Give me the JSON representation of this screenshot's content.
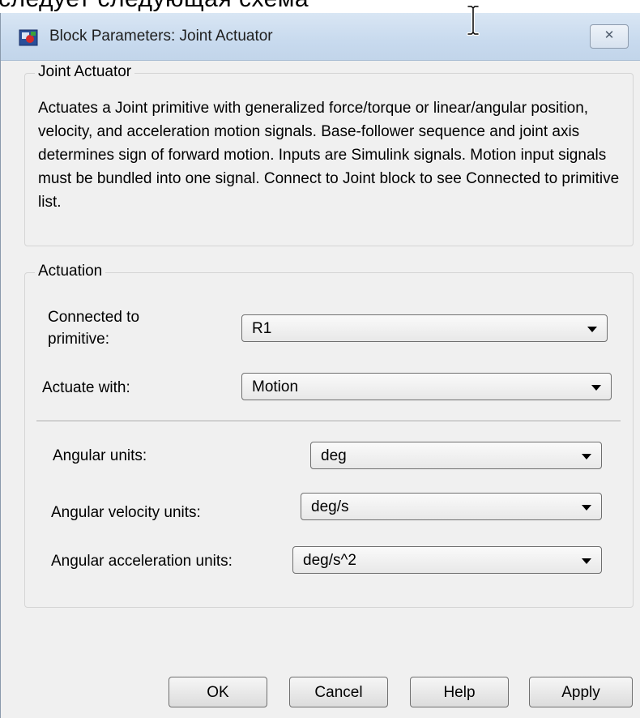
{
  "background_text": "следует следующая схема",
  "window": {
    "title": "Block Parameters: Joint Actuator",
    "close_glyph": "✕"
  },
  "description_group": {
    "title": "Joint Actuator",
    "text": "Actuates a Joint primitive with generalized force/torque or linear/angular position, velocity, and acceleration motion signals. Base-follower sequence and joint axis determines sign of forward motion. Inputs are Simulink signals. Motion input signals must be bundled into one signal. Connect to Joint block to see Connected to primitive list."
  },
  "actuation_group": {
    "title": "Actuation",
    "connected_to_label_line1": "Connected to",
    "connected_to_label_line2": "primitive:",
    "connected_to_value": "R1",
    "actuate_with_label": "Actuate with:",
    "actuate_with_value": "Motion",
    "angular_units_label": "Angular units:",
    "angular_units_value": "deg",
    "angular_velocity_units_label": "Angular velocity units:",
    "angular_velocity_units_value": "deg/s",
    "angular_acceleration_units_label": "Angular acceleration units:",
    "angular_acceleration_units_value": "deg/s^2"
  },
  "buttons": {
    "ok": "OK",
    "cancel": "Cancel",
    "help": "Help",
    "apply": "Apply"
  },
  "icons": {
    "title": "simulink-block-icon",
    "cursor": "text-ibeam-cursor",
    "dropdown": "chevron-down-icon"
  }
}
